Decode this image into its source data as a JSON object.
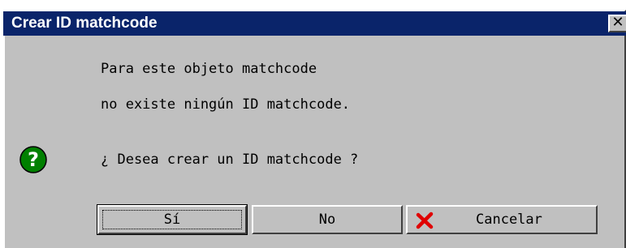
{
  "window": {
    "title": "Crear ID matchcode",
    "close_glyph": "✕"
  },
  "message": {
    "line1": "Para este objeto matchcode",
    "line2": "no existe ningún ID matchcode.",
    "question": "¿ Desea crear un ID matchcode ?"
  },
  "icons": {
    "question": "question-icon",
    "cancel": "red-x-icon",
    "question_color": "#008000",
    "cancel_color": "#e00000"
  },
  "buttons": {
    "yes_label": "Sí",
    "no_label": "No",
    "cancel_label": "Cancelar"
  },
  "colors": {
    "titlebar": "#0a246a",
    "dialog_bg": "#c0c0c0"
  }
}
